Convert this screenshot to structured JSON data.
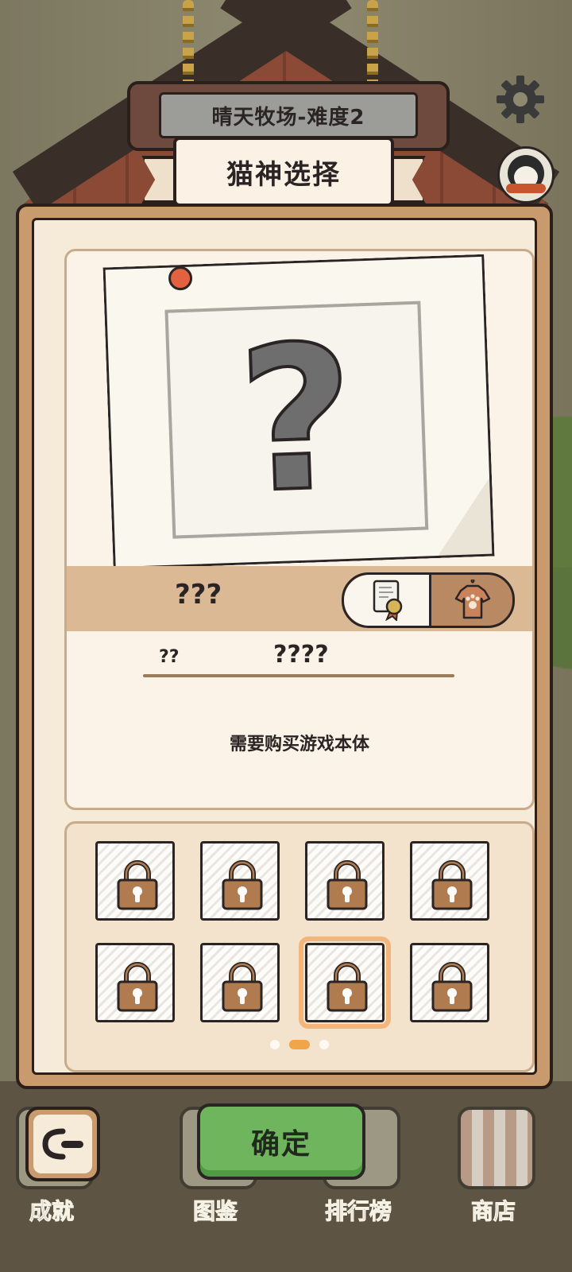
{
  "header": {
    "stage_sign": "晴天牧场-难度2",
    "title": "猫神选择"
  },
  "card": {
    "name": "???",
    "stat_label": "??",
    "stat_value": "????",
    "notice": "需要购买游戏本体"
  },
  "grid": {
    "pages": 3,
    "active_page": 2,
    "slots": [
      {
        "locked": true,
        "selected": false
      },
      {
        "locked": true,
        "selected": false
      },
      {
        "locked": true,
        "selected": false
      },
      {
        "locked": true,
        "selected": false
      },
      {
        "locked": true,
        "selected": false
      },
      {
        "locked": true,
        "selected": false
      },
      {
        "locked": true,
        "selected": true
      },
      {
        "locked": true,
        "selected": false
      }
    ]
  },
  "actions": {
    "confirm_label": "确定"
  },
  "nav": {
    "achievements": "成就",
    "collection": "图鉴",
    "leaderboard": "排行榜",
    "shop": "商店"
  },
  "colors": {
    "panel": "#c89a6e",
    "panel_inner": "#f6ead8",
    "confirm_green": "#6fb55e",
    "selected_outline": "#f2b57c",
    "page_dot_active": "#f0a54a"
  },
  "icons": {
    "settings": "gear-icon",
    "profile": "penguin-avatar",
    "back": "back-arrow-icon",
    "certificate": "certificate-icon",
    "outfit": "shirt-icon",
    "lock": "lock-icon",
    "pin": "pushpin-icon"
  }
}
